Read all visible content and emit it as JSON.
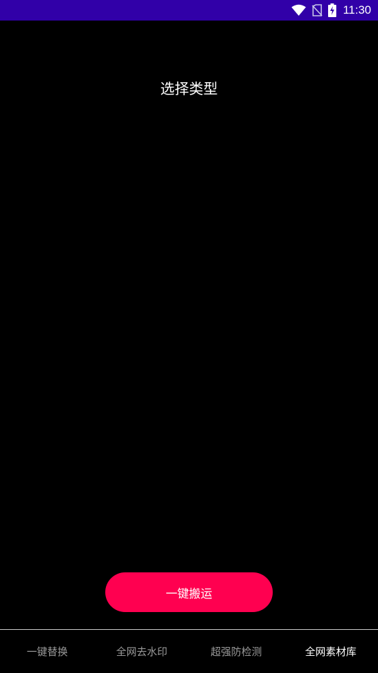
{
  "status_bar": {
    "time": "11:30",
    "icons": [
      "wifi-icon",
      "no-sim-icon",
      "battery-charging-icon"
    ],
    "background": "#3100a8"
  },
  "page": {
    "title": "选择类型"
  },
  "action_button": {
    "label": "一键搬运",
    "color": "#ff0050"
  },
  "bottom_nav": {
    "tabs": [
      {
        "label": "一键替换",
        "active": false
      },
      {
        "label": "全网去水印",
        "active": false
      },
      {
        "label": "超强防检测",
        "active": false
      },
      {
        "label": "全网素材库",
        "active": true
      }
    ]
  }
}
